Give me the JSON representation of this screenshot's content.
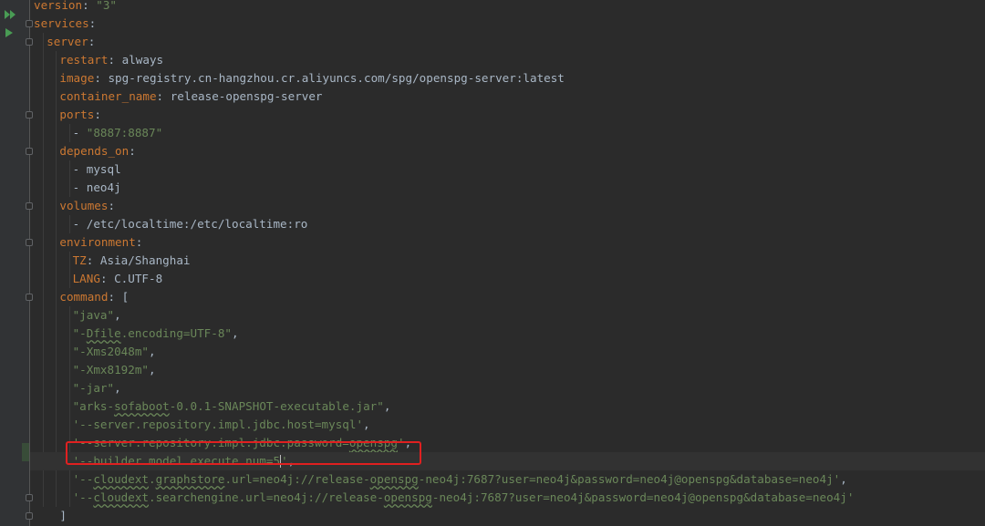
{
  "editor": {
    "lines": [
      {
        "indent": 0,
        "tokens": [
          [
            "k",
            "version"
          ],
          [
            "p",
            ": "
          ],
          [
            "s",
            "\"3\""
          ]
        ]
      },
      {
        "indent": 0,
        "tokens": [
          [
            "k",
            "services"
          ],
          [
            "p",
            ":"
          ]
        ]
      },
      {
        "indent": 1,
        "tokens": [
          [
            "k",
            "server"
          ],
          [
            "p",
            ":"
          ]
        ]
      },
      {
        "indent": 2,
        "tokens": [
          [
            "k",
            "restart"
          ],
          [
            "p",
            ": always"
          ]
        ]
      },
      {
        "indent": 2,
        "tokens": [
          [
            "k",
            "image"
          ],
          [
            "p",
            ": spg-registry.cn-hangzhou.cr.aliyuncs.com/spg/openspg-server:latest"
          ]
        ]
      },
      {
        "indent": 2,
        "tokens": [
          [
            "k",
            "container_name"
          ],
          [
            "p",
            ": release-openspg-server"
          ]
        ]
      },
      {
        "indent": 2,
        "tokens": [
          [
            "k",
            "ports"
          ],
          [
            "p",
            ":"
          ]
        ]
      },
      {
        "indent": 3,
        "tokens": [
          [
            "p",
            "- "
          ],
          [
            "s",
            "\"8887:8887\""
          ]
        ]
      },
      {
        "indent": 2,
        "tokens": [
          [
            "k",
            "depends_on"
          ],
          [
            "p",
            ":"
          ]
        ]
      },
      {
        "indent": 3,
        "tokens": [
          [
            "p",
            "- mysql"
          ]
        ]
      },
      {
        "indent": 3,
        "tokens": [
          [
            "p",
            "- neo4j"
          ]
        ]
      },
      {
        "indent": 2,
        "tokens": [
          [
            "k",
            "volumes"
          ],
          [
            "p",
            ":"
          ]
        ]
      },
      {
        "indent": 3,
        "tokens": [
          [
            "p",
            "- /etc/localtime:/etc/localtime:ro"
          ]
        ]
      },
      {
        "indent": 2,
        "tokens": [
          [
            "k",
            "environment"
          ],
          [
            "p",
            ":"
          ]
        ]
      },
      {
        "indent": 3,
        "tokens": [
          [
            "k",
            "TZ"
          ],
          [
            "p",
            ": Asia/Shanghai"
          ]
        ]
      },
      {
        "indent": 3,
        "tokens": [
          [
            "k",
            "LANG"
          ],
          [
            "p",
            ": C.UTF-8"
          ]
        ]
      },
      {
        "indent": 2,
        "tokens": [
          [
            "k",
            "command"
          ],
          [
            "p",
            ": ["
          ]
        ]
      },
      {
        "indent": 3,
        "tokens": [
          [
            "s",
            "\"java\""
          ],
          [
            "p",
            ","
          ]
        ]
      },
      {
        "indent": 3,
        "tokens": [
          [
            "s",
            "\"-"
          ],
          [
            "su",
            "Dfile"
          ],
          [
            "s",
            ".encoding=UTF-8\""
          ],
          [
            "p",
            ","
          ]
        ]
      },
      {
        "indent": 3,
        "tokens": [
          [
            "s",
            "\"-Xms2048m\""
          ],
          [
            "p",
            ","
          ]
        ]
      },
      {
        "indent": 3,
        "tokens": [
          [
            "s",
            "\"-Xmx8192m\""
          ],
          [
            "p",
            ","
          ]
        ]
      },
      {
        "indent": 3,
        "tokens": [
          [
            "s",
            "\"-jar\""
          ],
          [
            "p",
            ","
          ]
        ]
      },
      {
        "indent": 3,
        "tokens": [
          [
            "s",
            "\"arks-"
          ],
          [
            "su",
            "sofaboot"
          ],
          [
            "s",
            "-0.0.1-SNAPSHOT-executable.jar\""
          ],
          [
            "p",
            ","
          ]
        ]
      },
      {
        "indent": 3,
        "tokens": [
          [
            "s",
            "'--server.repository.impl.jdbc.host=mysql'"
          ],
          [
            "p",
            ","
          ]
        ]
      },
      {
        "indent": 3,
        "tokens": [
          [
            "s",
            "'--server.repository.impl.jdbc.password="
          ],
          [
            "su",
            "openspg"
          ],
          [
            "s",
            "'"
          ],
          [
            "p",
            ","
          ]
        ]
      },
      {
        "indent": 3,
        "tokens": [
          [
            "s",
            "'--builder.model.execute.num=5"
          ],
          [
            "caret",
            ""
          ],
          [
            "s",
            "'"
          ],
          [
            "p",
            ","
          ]
        ],
        "current": true
      },
      {
        "indent": 3,
        "tokens": [
          [
            "s",
            "'--"
          ],
          [
            "su",
            "cloudext"
          ],
          [
            "s",
            "."
          ],
          [
            "su",
            "graphstore"
          ],
          [
            "s",
            ".url=neo4j://release-"
          ],
          [
            "su",
            "openspg"
          ],
          [
            "s",
            "-neo4j:7687?user=neo4j&password=neo4j@openspg&database=neo4j'"
          ],
          [
            "p",
            ","
          ]
        ]
      },
      {
        "indent": 3,
        "tokens": [
          [
            "s",
            "'--"
          ],
          [
            "su",
            "cloudext"
          ],
          [
            "s",
            ".searchengine.url=neo4j://release-"
          ],
          [
            "su",
            "openspg"
          ],
          [
            "s",
            "-neo4j:7687?user=neo4j&password=neo4j@openspg&database=neo4j'"
          ]
        ]
      },
      {
        "indent": 2,
        "tokens": [
          [
            "p",
            "]"
          ]
        ]
      }
    ]
  },
  "colors": {
    "background": "#2b2b2b",
    "key": "#cc7832",
    "string": "#6a8759",
    "plain": "#a9b7c6",
    "highlight_box": "#e02020",
    "run_icon": "#499c54"
  },
  "gutter_icons": [
    "run-all-icon",
    "run-icon"
  ]
}
